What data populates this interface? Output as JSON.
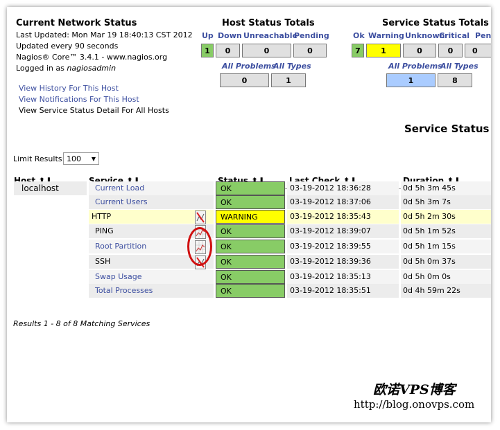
{
  "status": {
    "title": "Current Network Status",
    "last_updated": "Last Updated: Mon Mar 19 18:40:13 CST 2012",
    "interval": "Updated every 90 seconds",
    "version": "Nagios® Core™ 3.4.1 - www.nagios.org",
    "logged_prefix": "Logged in as ",
    "user": "nagiosadmin"
  },
  "links": [
    "View History For This Host",
    "View Notifications For This Host",
    "View Service Status Detail For All Hosts"
  ],
  "host_totals": {
    "title": "Host Status Totals",
    "labels": [
      "Up",
      "Down",
      "Unreachable",
      "Pending"
    ],
    "values": [
      "1",
      "0",
      "0",
      "0"
    ],
    "all_problems": "All Problems",
    "all_types": "All Types",
    "problems_value": "0",
    "types_value": "1"
  },
  "service_totals": {
    "title": "Service Status Totals",
    "labels": [
      "Ok",
      "Warning",
      "Unknown",
      "Critical",
      "Pending"
    ],
    "values": [
      "7",
      "1",
      "0",
      "0",
      "0"
    ],
    "all_problems": "All Problems",
    "all_types": "All Types",
    "problems_value": "1",
    "types_value": "8"
  },
  "page_title": "Service Status Details For Host 'localhost'",
  "limit": {
    "label": "Limit Results:",
    "value": "100"
  },
  "columns": [
    "Host",
    "Service",
    "Status",
    "Last Check",
    "Duration"
  ],
  "host": "localhost",
  "rows": [
    {
      "service": "Current Load",
      "status": "OK",
      "last_check": "03-19-2012 18:36:28",
      "duration": "0d 5h 3m 45s",
      "graph": ""
    },
    {
      "service": "Current Users",
      "status": "OK",
      "last_check": "03-19-2012 18:37:06",
      "duration": "0d 5h 3m 7s",
      "graph": ""
    },
    {
      "service": "HTTP",
      "status": "WARNING",
      "last_check": "03-19-2012 18:35:43",
      "duration": "0d 5h 2m 30s",
      "graph": "no-graph"
    },
    {
      "service": "PING",
      "status": "OK",
      "last_check": "03-19-2012 18:39:07",
      "duration": "0d 5h 1m 52s",
      "graph": "graph"
    },
    {
      "service": "Root Partition",
      "status": "OK",
      "last_check": "03-19-2012 18:39:55",
      "duration": "0d 5h 1m 15s",
      "graph": "graph"
    },
    {
      "service": "SSH",
      "status": "OK",
      "last_check": "03-19-2012 18:39:36",
      "duration": "0d 5h 0m 37s",
      "graph": "no-graph"
    },
    {
      "service": "Swap Usage",
      "status": "OK",
      "last_check": "03-19-2012 18:35:13",
      "duration": "0d 5h 0m 0s",
      "graph": ""
    },
    {
      "service": "Total Processes",
      "status": "OK",
      "last_check": "03-19-2012 18:35:51",
      "duration": "0d 4h 59m 22s",
      "graph": ""
    }
  ],
  "results": "Results 1 - 8 of 8 Matching Services",
  "watermark": {
    "name": "欧诺VPS博客",
    "url": "http://blog.onovps.com"
  },
  "colors": {
    "ok": "#88cc66",
    "warning": "#ffff00",
    "problems": "#aaccff",
    "warning_row": "#ffffcc",
    "link": "#3d4fa0"
  }
}
